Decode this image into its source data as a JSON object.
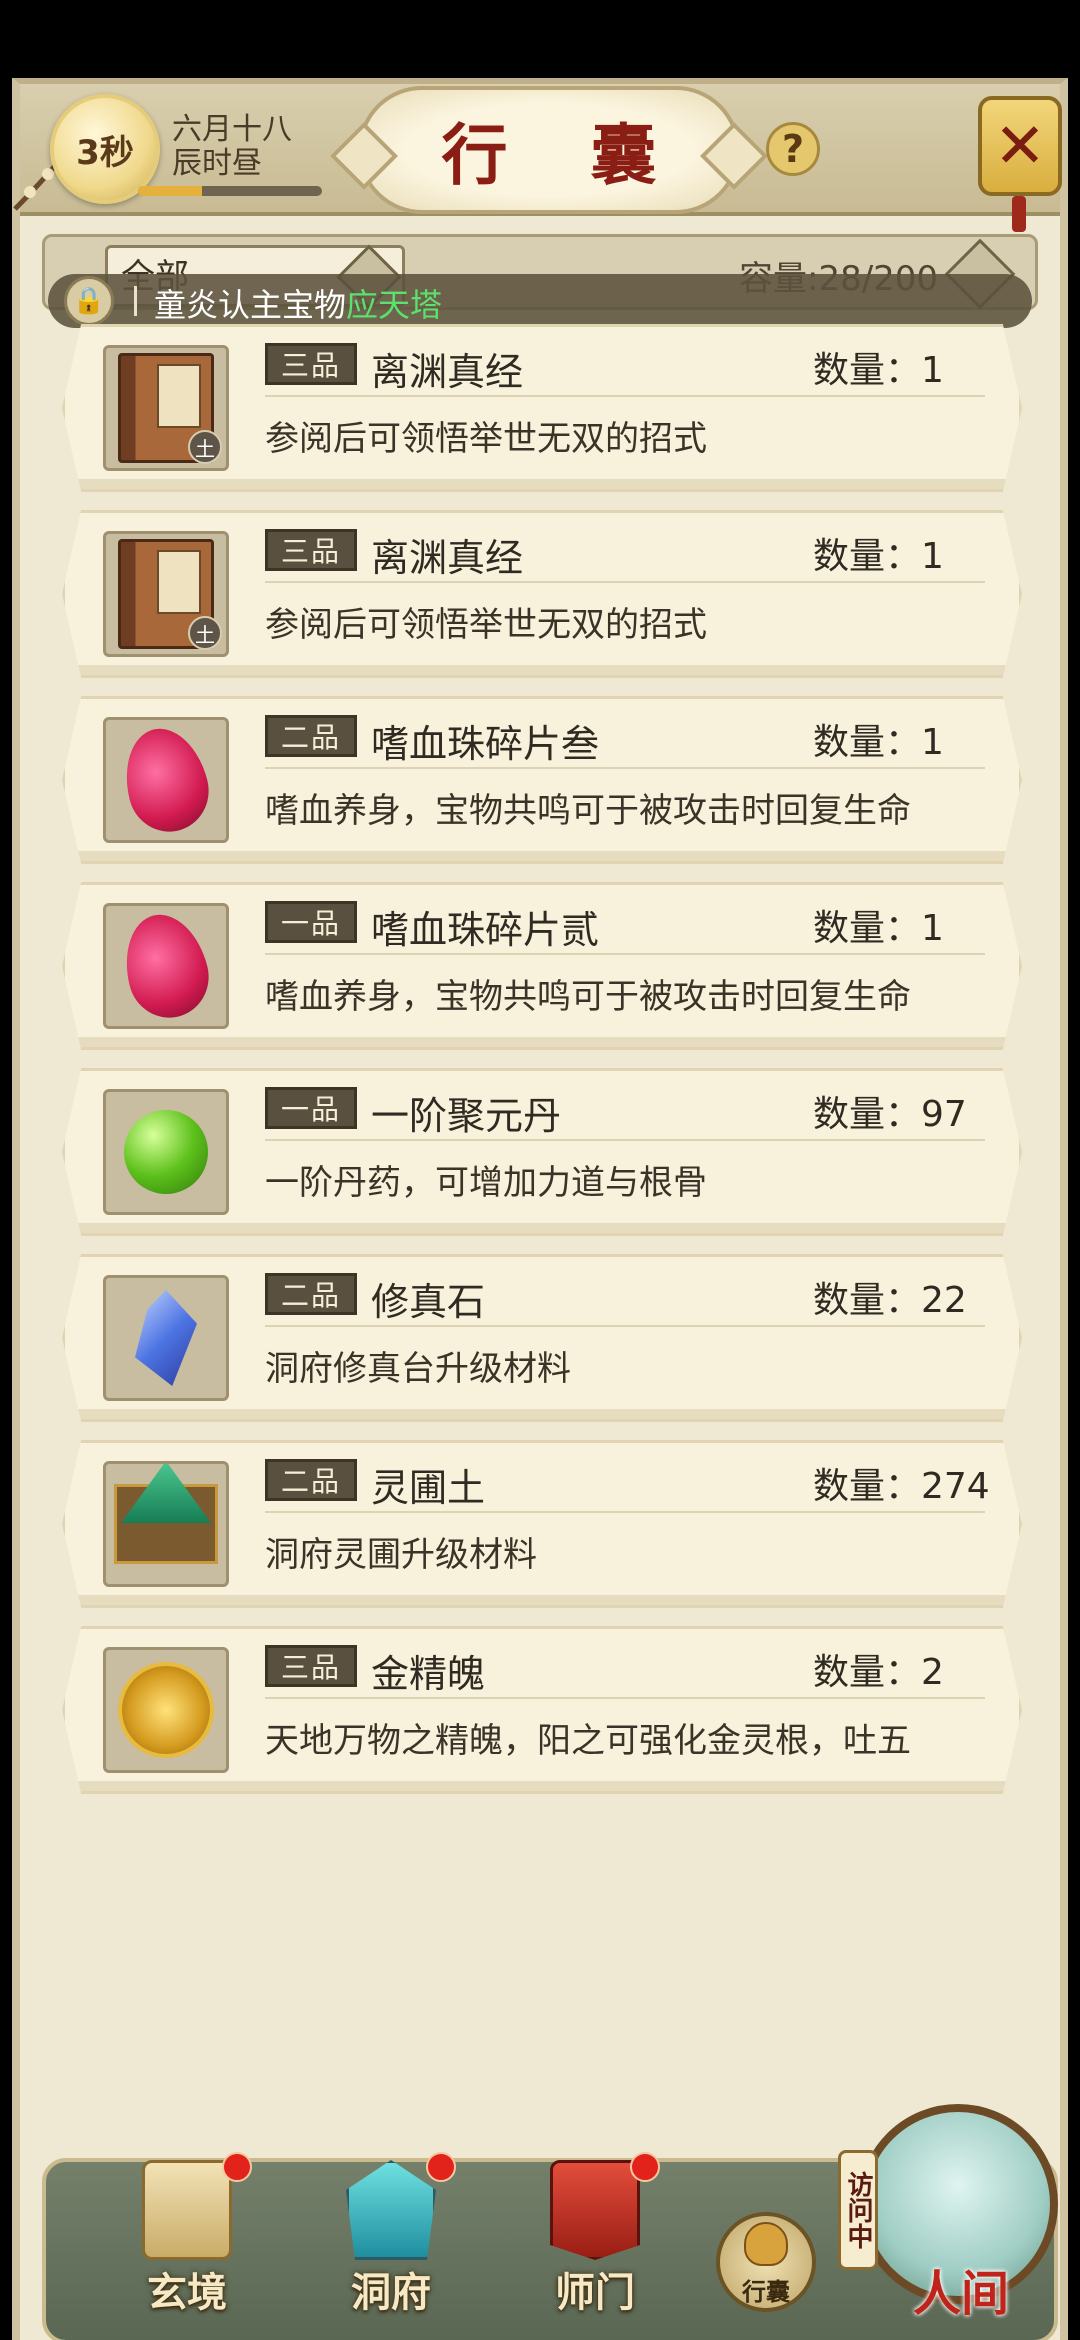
{
  "header": {
    "timer": "3秒",
    "date_line1": "六月十八",
    "date_line2": "辰时昼",
    "time_progress": 0.35,
    "title": "行 囊",
    "help_icon": "?",
    "close_icon": "✕"
  },
  "filter": {
    "selected": "全部",
    "capacity": "容量:28/200"
  },
  "notice": {
    "prefix": "童炎认主宝物",
    "highlight": "应天塔"
  },
  "items": [
    {
      "grade": "三品",
      "name": "离渊真经",
      "qty": "数量：1",
      "desc": "参阅后可领悟举世无双的招式",
      "icon": "book-icon",
      "badge": "土"
    },
    {
      "grade": "三品",
      "name": "离渊真经",
      "qty": "数量：1",
      "desc": "参阅后可领悟举世无双的招式",
      "icon": "book-icon",
      "badge": "土"
    },
    {
      "grade": "二品",
      "name": "嗜血珠碎片叁",
      "qty": "数量：1",
      "desc": "嗜血养身，宝物共鸣可于被攻击时回复生命",
      "icon": "shard-icon"
    },
    {
      "grade": "一品",
      "name": "嗜血珠碎片贰",
      "qty": "数量：1",
      "desc": "嗜血养身，宝物共鸣可于被攻击时回复生命",
      "icon": "shard-icon"
    },
    {
      "grade": "一品",
      "name": "一阶聚元丹",
      "qty": "数量：97",
      "desc": "一阶丹药，可增加力道与根骨",
      "icon": "pill-icon"
    },
    {
      "grade": "二品",
      "name": "修真石",
      "qty": "数量：22",
      "desc": "洞府修真台升级材料",
      "icon": "crystal-icon"
    },
    {
      "grade": "二品",
      "name": "灵圃土",
      "qty": "数量：274",
      "desc": "洞府灵圃升级材料",
      "icon": "soil-icon"
    },
    {
      "grade": "三品",
      "name": "金精魄",
      "qty": "数量：2",
      "desc": "天地万物之精魄，阳之可强化金灵根，吐五",
      "icon": "gold-icon"
    }
  ],
  "nav": {
    "xuanjing": "玄境",
    "dongfu": "洞府",
    "shimen": "师门",
    "bag": "行囊",
    "visit": "访问中",
    "renjian": "人间"
  },
  "colors": {
    "title_red": "#8b1e14",
    "highlight_green": "#5ce06e",
    "badge_red": "#e1231b"
  }
}
